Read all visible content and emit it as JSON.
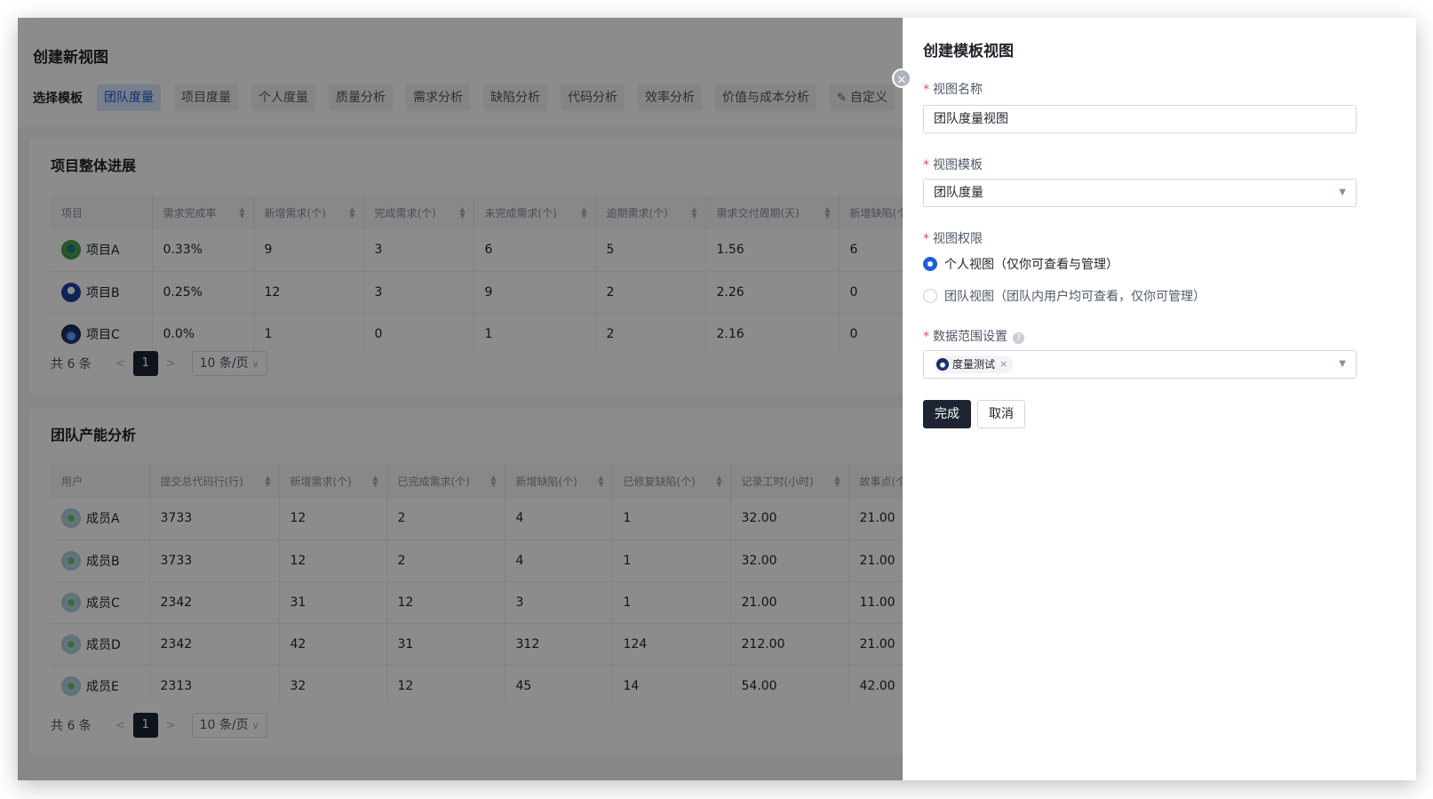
{
  "page": {
    "title": "创建新视图",
    "template_label": "选择模板",
    "template_tabs": [
      "团队度量",
      "项目度量",
      "个人度量",
      "质量分析",
      "需求分析",
      "缺陷分析",
      "代码分析",
      "效率分析",
      "价值与成本分析",
      "自定义"
    ],
    "active_tab_index": 0
  },
  "project_progress": {
    "title": "项目整体进展",
    "columns": [
      "项目",
      "需求完成率",
      "新增需求(个)",
      "完成需求(个)",
      "未完成需求(个)",
      "逾期需求(个)",
      "需求交付周期(天)",
      "新增缺陷(个"
    ],
    "rows": [
      {
        "name": "项目A",
        "avatar": "project-a-avatar",
        "cells": [
          "0.33%",
          "9",
          "3",
          "6",
          "5",
          "1.56",
          "6"
        ]
      },
      {
        "name": "项目B",
        "avatar": "project-b-avatar",
        "cells": [
          "0.25%",
          "12",
          "3",
          "9",
          "2",
          "2.26",
          "0"
        ]
      },
      {
        "name": "项目C",
        "avatar": "project-c-avatar",
        "cells": [
          "0.0%",
          "1",
          "0",
          "1",
          "2",
          "2.16",
          "0"
        ]
      }
    ],
    "pager": {
      "total": "共 6 条",
      "page": "1",
      "size": "10 条/页"
    }
  },
  "team_capacity": {
    "title": "团队产能分析",
    "columns": [
      "用户",
      "提交总代码行(行)",
      "新增需求(个)",
      "已完成需求(个)",
      "新增缺陷(个)",
      "已修复缺陷(个)",
      "记录工时(小时)",
      "故事点(个"
    ],
    "rows": [
      {
        "name": "成员A",
        "cells": [
          "3733",
          "12",
          "2",
          "4",
          "1",
          "32.00",
          "21.00"
        ]
      },
      {
        "name": "成员B",
        "cells": [
          "3733",
          "12",
          "2",
          "4",
          "1",
          "32.00",
          "21.00"
        ]
      },
      {
        "name": "成员C",
        "cells": [
          "2342",
          "31",
          "12",
          "3",
          "1",
          "21.00",
          "11.00"
        ]
      },
      {
        "name": "成员D",
        "cells": [
          "2342",
          "42",
          "31",
          "312",
          "124",
          "212.00",
          "21.00"
        ]
      },
      {
        "name": "成员E",
        "cells": [
          "2313",
          "32",
          "12",
          "45",
          "14",
          "54.00",
          "42.00"
        ]
      }
    ],
    "pager": {
      "total": "共 6 条",
      "page": "1",
      "size": "10 条/页"
    }
  },
  "drawer": {
    "title": "创建模板视图",
    "view_name_label": "视图名称",
    "view_name_value": "团队度量视图",
    "view_template_label": "视图模板",
    "view_template_value": "团队度量",
    "permission_label": "视图权限",
    "permission_options": [
      "个人视图（仅你可查看与管理）",
      "团队视图（团队内用户均可查看，仅你可管理）"
    ],
    "permission_selected": 0,
    "data_scope_label": "数据范围设置",
    "data_scope_tags": [
      "度量测试"
    ],
    "ok_label": "完成",
    "cancel_label": "取消"
  },
  "colors": {
    "accent": "#1d5ed8",
    "primary_button": "#1d2432",
    "required_mark": "#e34d4d"
  }
}
